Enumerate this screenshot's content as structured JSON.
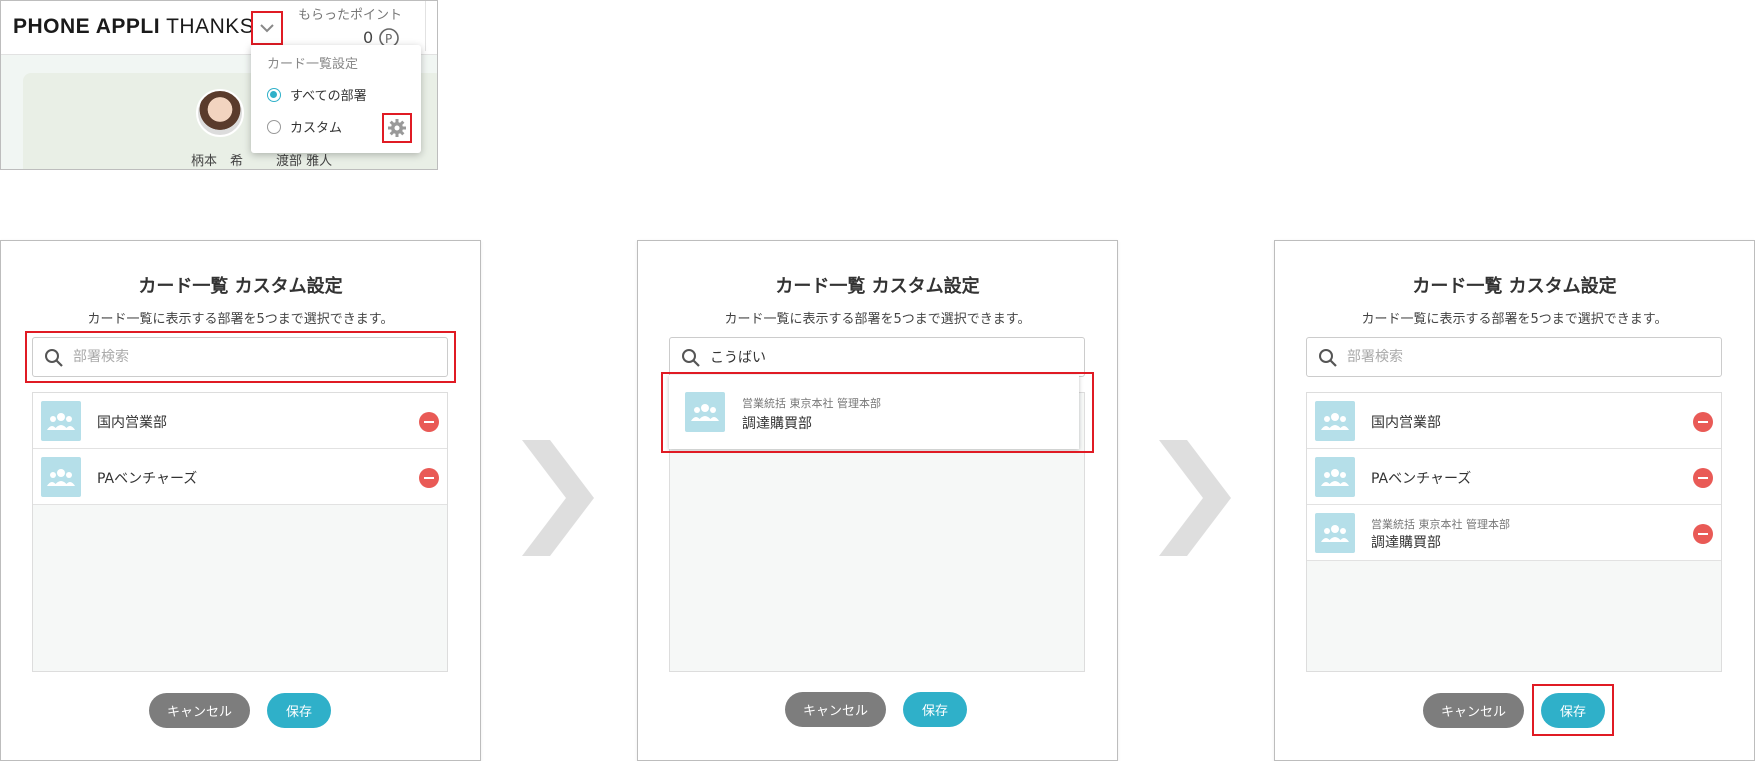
{
  "header": {
    "brand_bold": "PHONE APPLI",
    "brand_light": "THANKS",
    "points_label": "もらったポイント",
    "points_value": "0"
  },
  "people": [
    "柄本　希",
    "渡部 雅人"
  ],
  "dropdown": {
    "title": "カード一覧設定",
    "options": [
      {
        "label": "すべての部署",
        "selected": true
      },
      {
        "label": "カスタム",
        "selected": false
      }
    ]
  },
  "dialog": {
    "title": "カード一覧 カスタム設定",
    "subtitle": "カード一覧に表示する部署を5つまで選択できます。",
    "search_placeholder": "部署検索",
    "cancel_label": "キャンセル",
    "save_label": "保存"
  },
  "step1": {
    "items": [
      {
        "name": "国内営業部"
      },
      {
        "name": "PAベンチャーズ"
      }
    ]
  },
  "step2": {
    "search_value": "こうばい",
    "result": {
      "path": "営業統括 東京本社 管理本部",
      "name": "調達購買部"
    }
  },
  "step3": {
    "items": [
      {
        "name": "国内営業部"
      },
      {
        "name": "PAベンチャーズ"
      },
      {
        "path": "営業統括 東京本社 管理本部",
        "name": "調達購買部"
      }
    ]
  },
  "colors": {
    "accent": "#2fb0c9",
    "highlight": "#e01b24",
    "remove": "#e95a56",
    "cancel": "#7d7d7d",
    "dept_icon_bg": "#b5dfe9"
  }
}
